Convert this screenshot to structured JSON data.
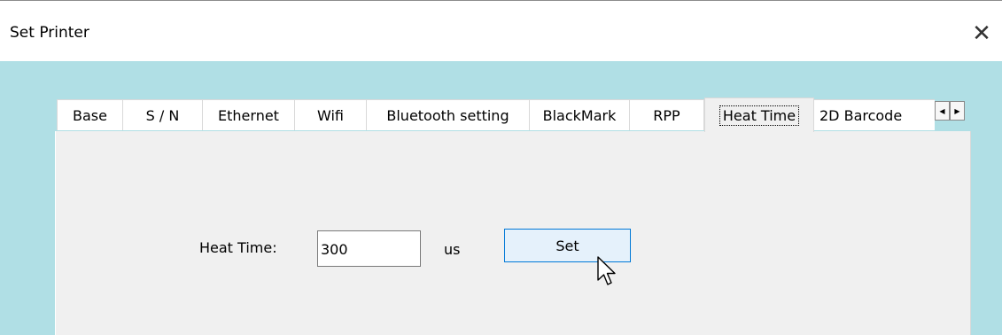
{
  "window": {
    "title": "Set Printer",
    "close_glyph": "✕"
  },
  "tabs": [
    {
      "label": "Base"
    },
    {
      "label": "S / N"
    },
    {
      "label": "Ethernet"
    },
    {
      "label": "Wifi"
    },
    {
      "label": "Bluetooth setting"
    },
    {
      "label": "BlackMark"
    },
    {
      "label": "RPP"
    },
    {
      "label": "Heat Time",
      "selected": true
    },
    {
      "label": "2D Barcode"
    }
  ],
  "tab_scroll": {
    "left_glyph": "◀",
    "right_glyph": "▶"
  },
  "heat_time": {
    "label": "Heat Time:",
    "value": "300",
    "unit": "us",
    "set_label": "Set"
  },
  "colors": {
    "client_background": "#b0dfe5",
    "panel_background": "#f0f0f0",
    "button_hover_border": "#0078d7",
    "button_hover_fill": "#e5f1fb"
  },
  "icons": {
    "cursor": "mouse-pointer-icon"
  }
}
